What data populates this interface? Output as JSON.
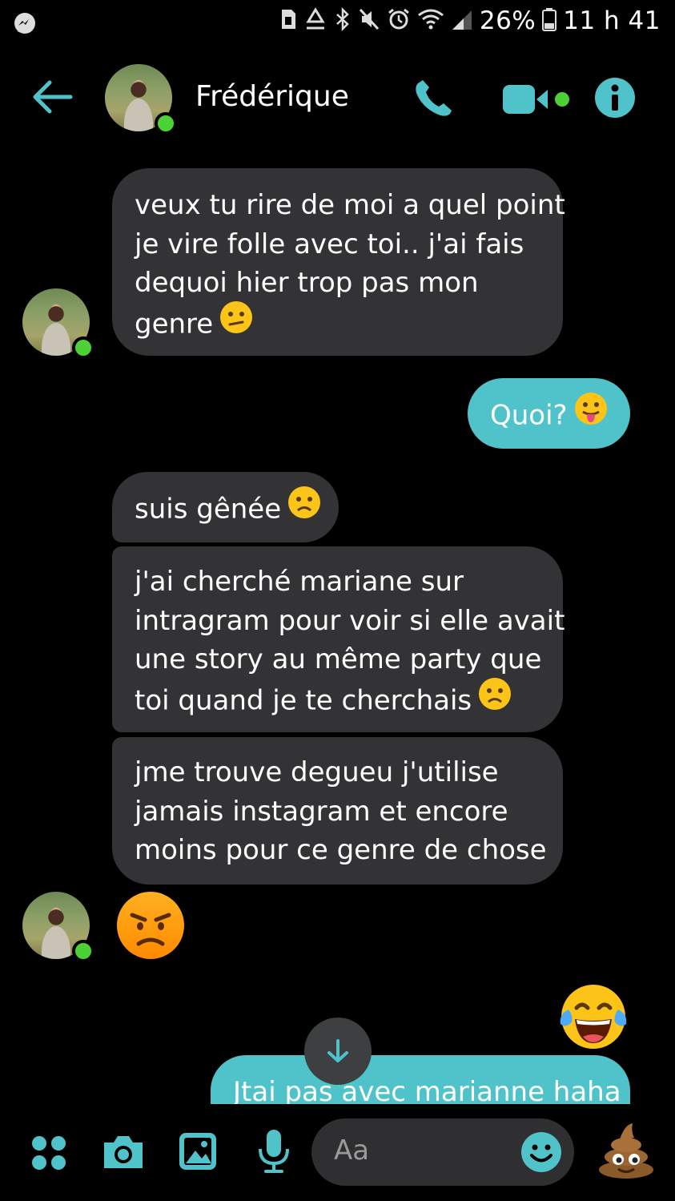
{
  "status_bar": {
    "battery_percent": "26%",
    "time": "11 h 41",
    "icons": [
      "messenger-icon",
      "sim-icon",
      "recycle-icon",
      "bluetooth-icon",
      "mute-icon",
      "alarm-icon",
      "wifi-icon",
      "signal-icon",
      "battery-icon"
    ]
  },
  "header": {
    "contact_name": "Frédérique",
    "online": true,
    "accent": "#4fc3c9"
  },
  "messages": [
    {
      "sender": "contact",
      "lines": [
        "veux tu rire de moi a quel point",
        "je vire folle avec toi.. j'ai fais",
        "dequoi hier trop pas mon",
        "genre"
      ],
      "emoji": "confused-face-emoji"
    },
    {
      "sender": "me",
      "lines": [
        "Quoi?"
      ],
      "emoji": "tongue-face-emoji"
    },
    {
      "sender": "contact",
      "lines": [
        "suis gênée"
      ],
      "emoji": "frowning-face-emoji"
    },
    {
      "sender": "contact",
      "lines": [
        "j'ai cherché mariane sur",
        "intragram pour voir si elle avait",
        "une story au même party que",
        "toi quand je te cherchais"
      ],
      "emoji": "frowning-face-emoji"
    },
    {
      "sender": "contact",
      "lines": [
        "jme trouve degueu j'utilise",
        "jamais instagram et encore",
        "moins pour ce genre de chose"
      ]
    },
    {
      "sender": "contact",
      "big_emoji": "angry-face-emoji"
    },
    {
      "sender": "me",
      "big_emoji": "tears-of-joy-emoji"
    },
    {
      "sender": "me",
      "lines": [
        "Jtai pas avec marianne haha"
      ]
    }
  ],
  "composer": {
    "placeholder": "Aa",
    "icons": [
      "apps-icon",
      "camera-icon",
      "gallery-icon",
      "microphone-icon",
      "emoji-picker-icon",
      "poop-emoji-button"
    ]
  },
  "colors": {
    "incoming_bubble": "#333335",
    "outgoing_bubble": "#4fc3c9",
    "background": "#000000",
    "online": "#4cd137"
  }
}
